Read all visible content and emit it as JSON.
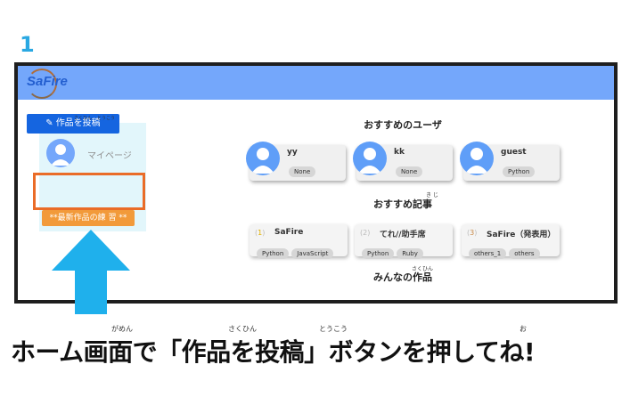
{
  "step_number": "1",
  "app": {
    "logo": "SaFire"
  },
  "sidebar": {
    "mypage_label": "マイページ",
    "post_button_label": "作品を投稿",
    "post_button_ruby": [
      "さくひん",
      "とうこう"
    ],
    "practice_button_label": "**最新作品の練 習 **"
  },
  "recommended_users": {
    "title": "おすすめのユーザ",
    "users": [
      {
        "name": "yy",
        "tag": "None"
      },
      {
        "name": "kk",
        "tag": "None"
      },
      {
        "name": "guest",
        "tag": "Python"
      }
    ]
  },
  "recommended_articles": {
    "title": "おすすめ記事",
    "title_ruby": "き じ",
    "articles": [
      {
        "rank": "1",
        "title": "SaFire",
        "tags": [
          "Python",
          "JavaScript"
        ]
      },
      {
        "rank": "2",
        "title": "てれ//助手席",
        "tags": [
          "Python",
          "Ruby"
        ]
      },
      {
        "rank": "3",
        "title": "SaFire（発表用）",
        "tags": [
          "others_1",
          "others"
        ]
      }
    ]
  },
  "everyone_works": {
    "title": "みんなの作品",
    "title_ruby": "さくひん"
  },
  "caption": {
    "text": "ホーム画面で「作品を投稿」ボタンを押してね!",
    "ruby": [
      "がめん",
      "さくひん",
      "とうこう",
      "お"
    ]
  },
  "colors": {
    "topbar": "#74a7fb",
    "post_button": "#1565e0",
    "practice_button": "#f29a3a",
    "highlight_box": "#ea6c28",
    "arrow": "#1fb0ec",
    "step_number": "#2aa8e2"
  }
}
